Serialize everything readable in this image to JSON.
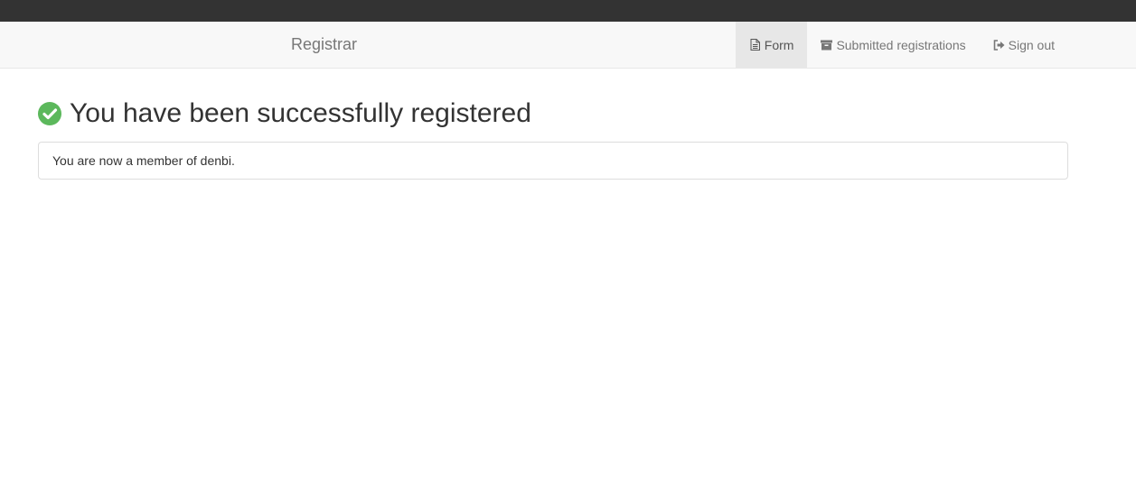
{
  "navbar": {
    "brand": "Registrar",
    "items": [
      {
        "label": "Form",
        "icon": "file-text-icon",
        "active": true
      },
      {
        "label": "Submitted registrations",
        "icon": "archive-icon",
        "active": false
      },
      {
        "label": "Sign out",
        "icon": "sign-out-icon",
        "active": false
      }
    ]
  },
  "main": {
    "heading": "You have been successfully registered",
    "heading_icon": "check-circle-icon",
    "message": "You are now a member of denbi."
  },
  "colors": {
    "topbar": "#333333",
    "navbar_bg": "#f8f8f8",
    "nav_active_bg": "#e7e7e7",
    "success": "#5cb85c"
  }
}
